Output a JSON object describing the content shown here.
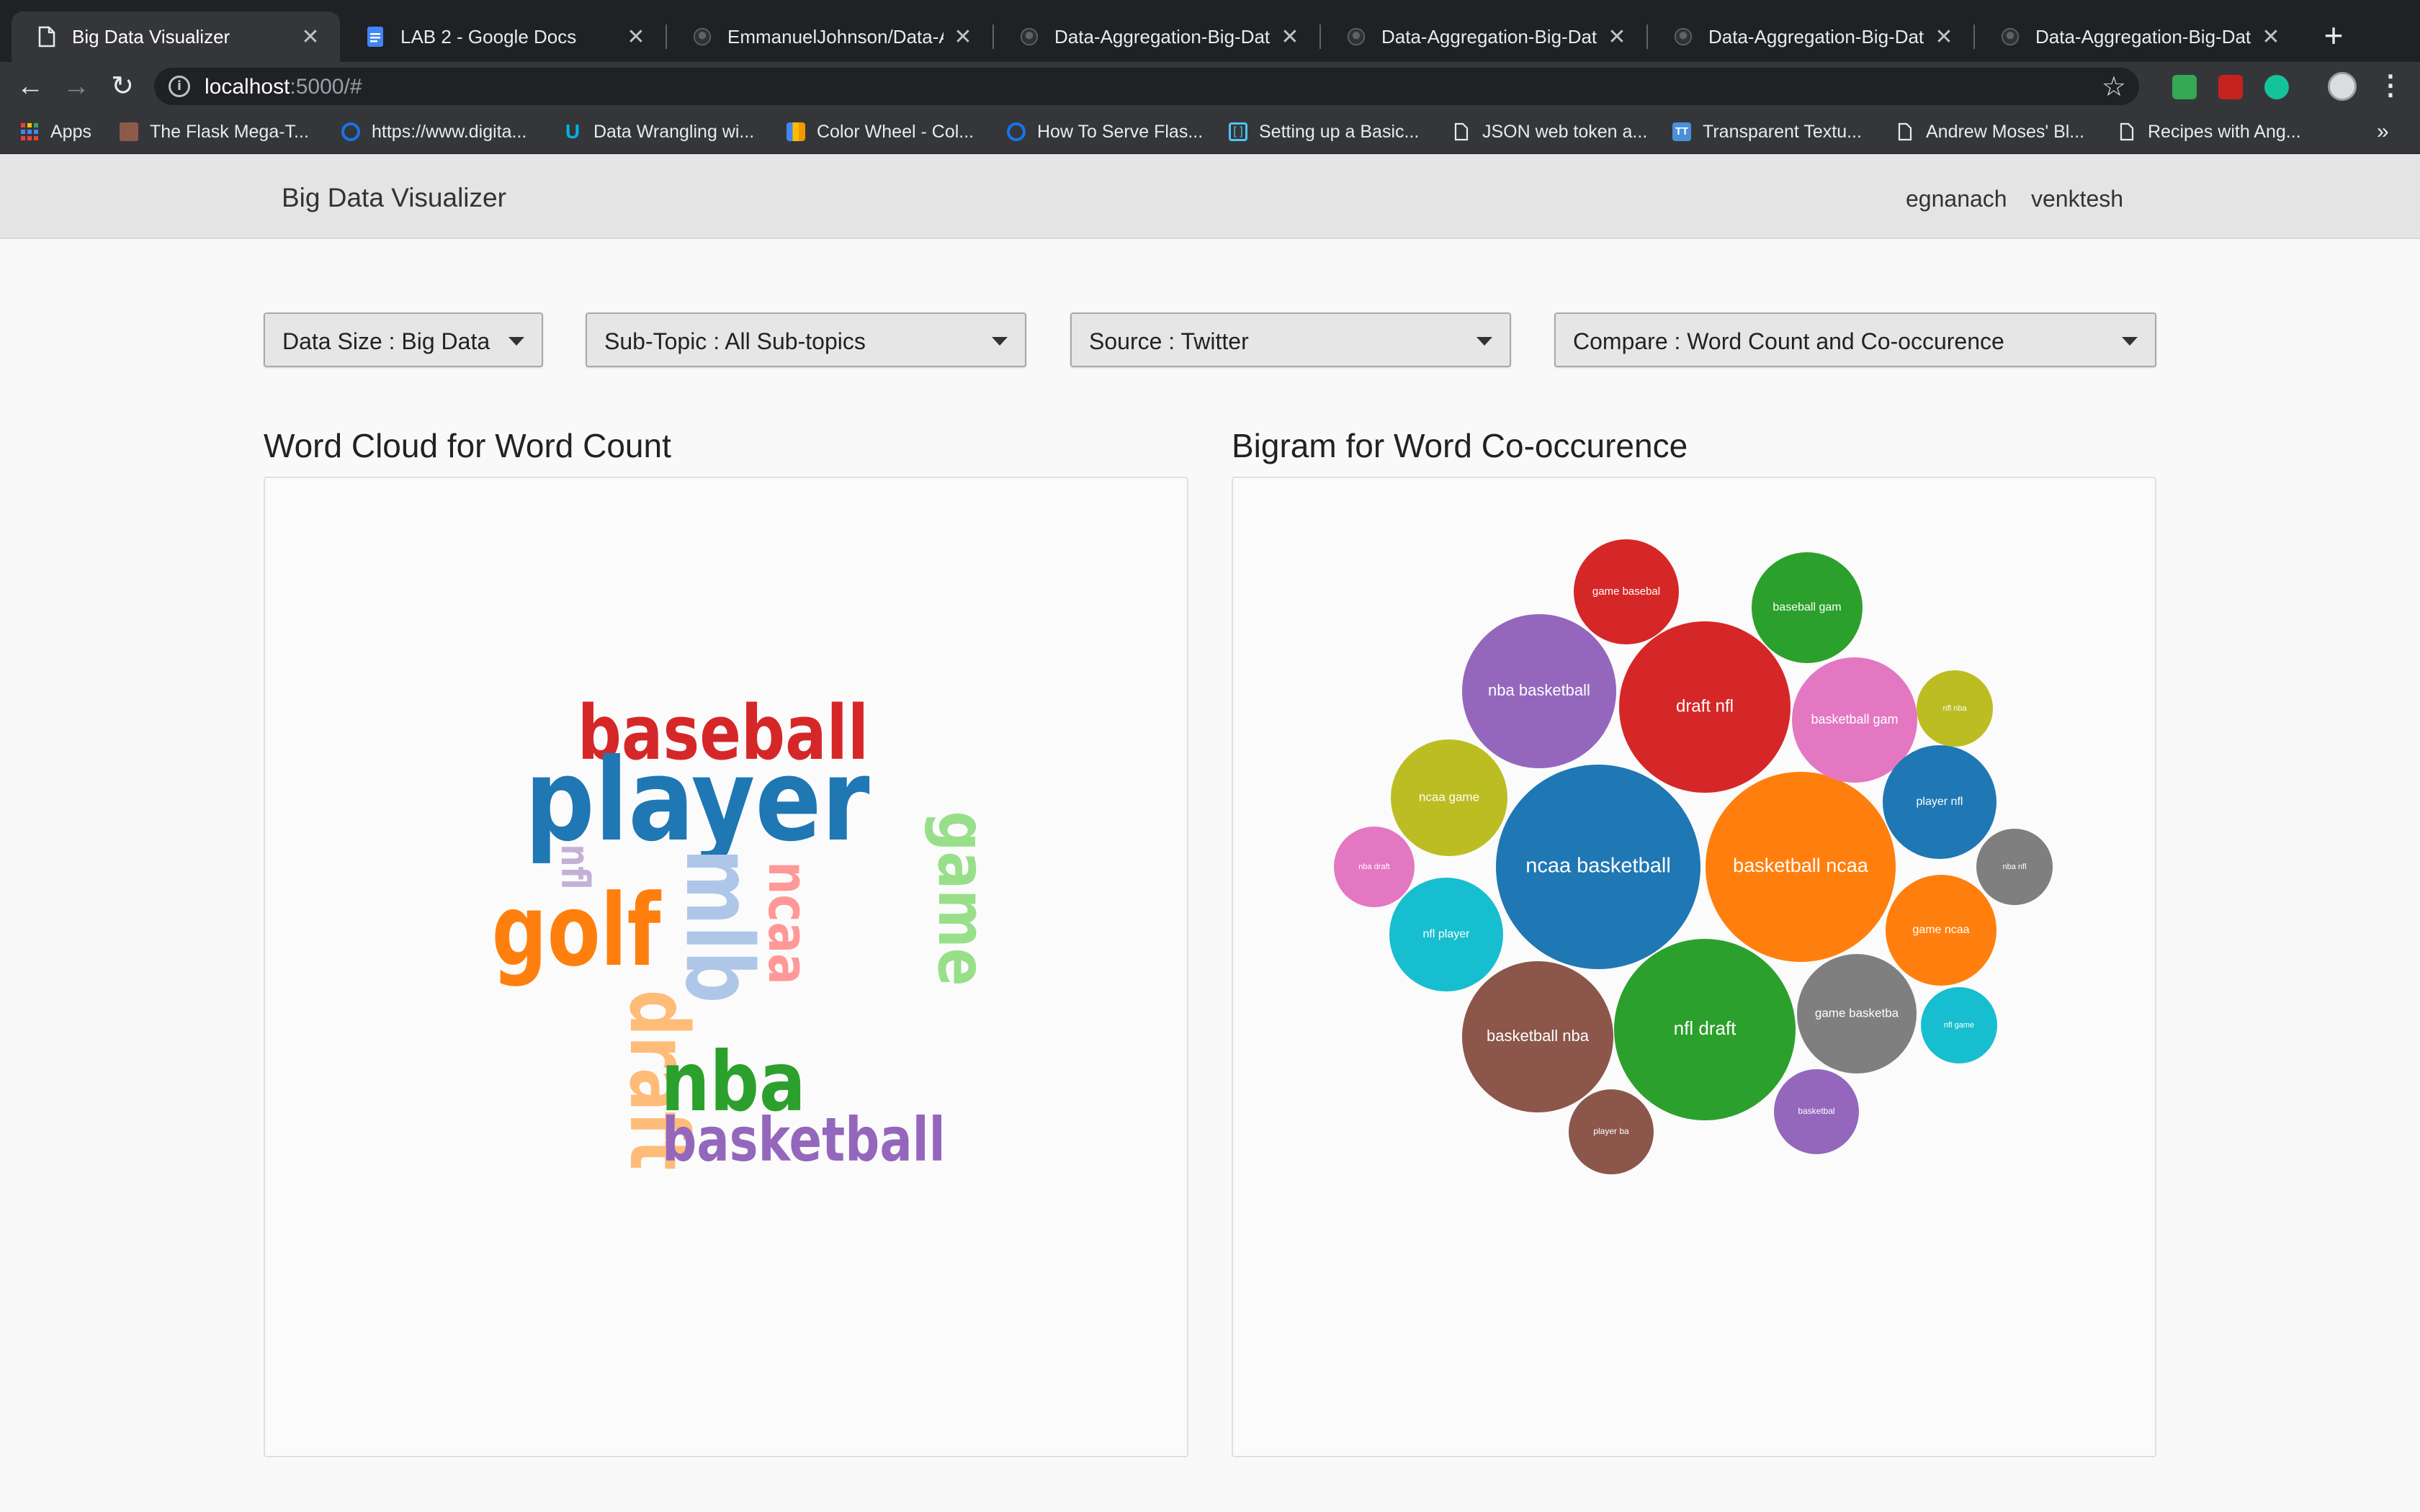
{
  "browser": {
    "tabs": [
      {
        "title": "Big Data Visualizer",
        "active": true,
        "icon": "page-icon"
      },
      {
        "title": "LAB 2 - Google Docs",
        "active": false,
        "icon": "google-docs-icon"
      },
      {
        "title": "EmmanuelJohnson/Data-Agg",
        "active": false,
        "icon": "github-icon"
      },
      {
        "title": "Data-Aggregation-Big-Data-",
        "active": false,
        "icon": "github-icon"
      },
      {
        "title": "Data-Aggregation-Big-Data-",
        "active": false,
        "icon": "github-icon"
      },
      {
        "title": "Data-Aggregation-Big-Data-",
        "active": false,
        "icon": "github-icon"
      },
      {
        "title": "Data-Aggregation-Big-Data-",
        "active": false,
        "icon": "github-icon"
      }
    ],
    "address": {
      "host": "localhost",
      "rest": ":5000/#"
    },
    "bookmarks": [
      {
        "label": "Apps",
        "icon": "apps-grid-icon"
      },
      {
        "label": "The Flask Mega-T...",
        "icon": "avatar-icon"
      },
      {
        "label": "https://www.digita...",
        "icon": "digitalocean-icon"
      },
      {
        "label": "Data Wrangling wi...",
        "icon": "udacity-icon"
      },
      {
        "label": "Color Wheel - Col...",
        "icon": "color-wheel-icon"
      },
      {
        "label": "How To Serve Flas...",
        "icon": "digitalocean-icon"
      },
      {
        "label": "Setting up a Basic...",
        "icon": "bracket-icon"
      },
      {
        "label": "JSON web token a...",
        "icon": "page-icon"
      },
      {
        "label": "Transparent Textu...",
        "icon": "tt-icon"
      },
      {
        "label": "Andrew Moses' Bl...",
        "icon": "page-icon"
      },
      {
        "label": "Recipes with Ang...",
        "icon": "page-icon"
      }
    ]
  },
  "navbar": {
    "brand": "Big Data Visualizer",
    "links": [
      "egnanach",
      "venktesh"
    ]
  },
  "filters": [
    {
      "label": "Data Size : Big Data"
    },
    {
      "label": "Sub-Topic :  All Sub-topics"
    },
    {
      "label": "Source : Twitter"
    },
    {
      "label": "Compare : Word Count and Co-occurence"
    }
  ],
  "panels": {
    "left_title": "Word Cloud for Word Count",
    "right_title": "Bigram for Word Co-occurence"
  },
  "word_cloud": {
    "words": [
      {
        "text": "baseball",
        "color": "#d62728"
      },
      {
        "text": "player",
        "color": "#1f77b4"
      },
      {
        "text": "game",
        "color": "#98df8a"
      },
      {
        "text": "golf",
        "color": "#ff7f0e"
      },
      {
        "text": "nfl",
        "color": "#c5b0d5"
      },
      {
        "text": "mlb",
        "color": "#aec7e8"
      },
      {
        "text": "ncaa",
        "color": "#ff9896"
      },
      {
        "text": "draft",
        "color": "#ffbb78"
      },
      {
        "text": "nba",
        "color": "#2ca02c"
      },
      {
        "text": "basketball",
        "color": "#9467bd"
      }
    ]
  },
  "bigram_bubbles": [
    {
      "label": "ncaa basketball",
      "color": "#1f77b4"
    },
    {
      "label": "basketball ncaa",
      "color": "#ff7f0e"
    },
    {
      "label": "nfl draft",
      "color": "#2ca02c"
    },
    {
      "label": "draft nfl",
      "color": "#d62728"
    },
    {
      "label": "nba basketball",
      "color": "#9467bd"
    },
    {
      "label": "basketball nba",
      "color": "#8c564b"
    },
    {
      "label": "basketball gam",
      "color": "#e377c2"
    },
    {
      "label": "game basketba",
      "color": "#7f7f7f"
    },
    {
      "label": "ncaa game",
      "color": "#bcbd22"
    },
    {
      "label": "nfl player",
      "color": "#17becf"
    },
    {
      "label": "player nfl",
      "color": "#1f77b4"
    },
    {
      "label": "game ncaa",
      "color": "#ff7f0e"
    },
    {
      "label": "baseball gam",
      "color": "#2ca02c"
    },
    {
      "label": "game basebal",
      "color": "#d62728"
    },
    {
      "label": "basketbal",
      "color": "#9467bd"
    },
    {
      "label": "player ba",
      "color": "#8c564b"
    },
    {
      "label": "nba draft",
      "color": "#e377c2"
    },
    {
      "label": "nba nfl",
      "color": "#7f7f7f"
    },
    {
      "label": "nfl nba",
      "color": "#bcbd22"
    },
    {
      "label": "nfl game",
      "color": "#17becf"
    }
  ]
}
